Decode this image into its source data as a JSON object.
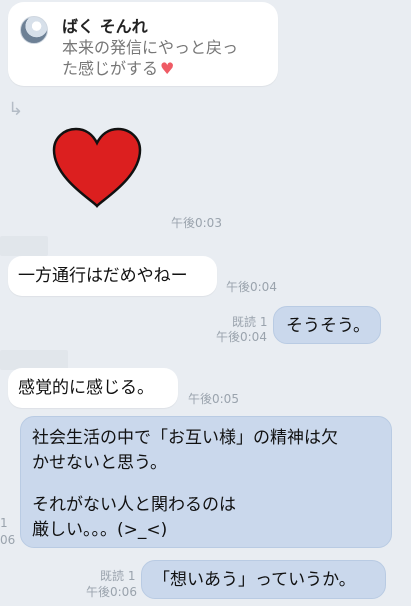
{
  "quote": {
    "sender": "ばく そんれ",
    "line1": "本来の発信にやっと戻っ",
    "line2": "た感じがする",
    "heart": "♥"
  },
  "reply_arrow": "↳",
  "messages": {
    "m1_time": "午後0:03",
    "m2_text": "一方通行はだめやねー",
    "m2_time": "午後0:04",
    "m3_read": "既読 1",
    "m3_time": "午後0:04",
    "m3_text": "そうそう。",
    "m4_text": "感覚的に感じる。",
    "m4_time": "午後0:05",
    "m5_line1": "社会生活の中で「お互い様」の精神は欠",
    "m5_line2": "かせないと思う。",
    "m5_line3": "それがない人と関わるのは",
    "m5_line4": "厳しい。。。(>_<)",
    "m5_side_read": "1",
    "m5_side_time": "06",
    "m6_read": "既読 1",
    "m6_time": "午後0:06",
    "m6_text": "「想いあう」っていうか。"
  },
  "colors": {
    "background": "#e9edf2",
    "left_bubble": "#ffffff",
    "right_bubble": "#cad8ec",
    "heart": "#dc1f1f"
  }
}
